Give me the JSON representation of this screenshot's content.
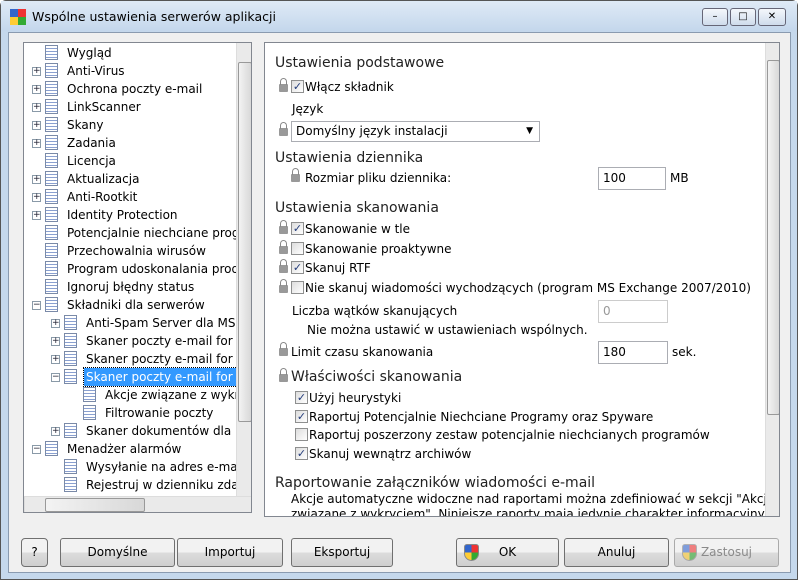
{
  "window": {
    "title": "Wspólne ustawienia serwerów aplikacji",
    "minimize": "–",
    "maximize": "□",
    "close": "✕"
  },
  "tree": [
    {
      "label": "Wygląd",
      "level": 0,
      "exp": ""
    },
    {
      "label": "Anti-Virus",
      "level": 0,
      "exp": "+"
    },
    {
      "label": "Ochrona poczty e-mail",
      "level": 0,
      "exp": "+"
    },
    {
      "label": "LinkScanner",
      "level": 0,
      "exp": "+"
    },
    {
      "label": "Skany",
      "level": 0,
      "exp": "+"
    },
    {
      "label": "Zadania",
      "level": 0,
      "exp": "+"
    },
    {
      "label": "Licencja",
      "level": 0,
      "exp": ""
    },
    {
      "label": "Aktualizacja",
      "level": 0,
      "exp": "+"
    },
    {
      "label": "Anti-Rootkit",
      "level": 0,
      "exp": "+"
    },
    {
      "label": "Identity Protection",
      "level": 0,
      "exp": "+"
    },
    {
      "label": "Potencjalnie niechciane programy",
      "level": 0,
      "exp": ""
    },
    {
      "label": "Przechowalnia wirusów",
      "level": 0,
      "exp": ""
    },
    {
      "label": "Program udoskonalania produktu",
      "level": 0,
      "exp": ""
    },
    {
      "label": "Ignoruj błędny status",
      "level": 0,
      "exp": ""
    },
    {
      "label": "Składniki dla serwerów",
      "level": 0,
      "exp": "−"
    },
    {
      "label": "Anti-Spam Server dla MS Exchange",
      "level": 1,
      "exp": "+"
    },
    {
      "label": "Skaner poczty e-mail for MS Exchange",
      "level": 1,
      "exp": "+"
    },
    {
      "label": "Skaner poczty e-mail for MS Exchange",
      "level": 1,
      "exp": "+"
    },
    {
      "label": "Skaner poczty e-mail for MS Exchange",
      "level": 1,
      "exp": "−",
      "selected": true
    },
    {
      "label": "Akcje związane z wykryciem",
      "level": 2,
      "exp": ""
    },
    {
      "label": "Filtrowanie poczty",
      "level": 2,
      "exp": ""
    },
    {
      "label": "Skaner dokumentów dla MS SharePoint",
      "level": 1,
      "exp": "+"
    },
    {
      "label": "Menadżer alarmów",
      "level": 0,
      "exp": "−"
    },
    {
      "label": "Wysyłanie na adres e-mail",
      "level": 1,
      "exp": ""
    },
    {
      "label": "Rejestruj w dzienniku zdarzeń",
      "level": 1,
      "exp": ""
    }
  ],
  "settings": {
    "basic": {
      "heading": "Ustawienia podstawowe",
      "enable_label": "Włącz składnik",
      "enable_checked": true,
      "language_label": "Język",
      "language_value": "Domyślny język instalacji"
    },
    "log": {
      "heading": "Ustawienia dziennika",
      "size_label": "Rozmiar pliku dziennika:",
      "size_value": "100",
      "size_unit": "MB"
    },
    "scan": {
      "heading": "Ustawienia skanowania",
      "options": [
        {
          "label": "Skanowanie w tle",
          "checked": true
        },
        {
          "label": "Skanowanie proaktywne",
          "checked": false
        },
        {
          "label": "Skanuj RTF",
          "checked": true
        },
        {
          "label": "Nie skanuj wiadomości wychodzących (program MS Exchange 2007/2010)",
          "checked": false
        }
      ],
      "threads_label": "Liczba wątków skanujących",
      "threads_value": "0",
      "threads_note": "Nie można ustawić w ustawieniach wspólnych.",
      "timeout_label": "Limit czasu skanowania",
      "timeout_value": "180",
      "timeout_unit": "sek."
    },
    "props": {
      "heading": "Właściwości skanowania",
      "options": [
        {
          "label": "Użyj heurystyki",
          "checked": true
        },
        {
          "label": "Raportuj Potencjalnie Niechciane Programy oraz Spyware",
          "checked": true
        },
        {
          "label": "Raportuj poszerzony zestaw potencjalnie niechcianych programów",
          "checked": false
        },
        {
          "label": "Skanuj wewnątrz archiwów",
          "checked": true
        }
      ]
    },
    "attach": {
      "heading": "Raportowanie załączników wiadomości e-mail",
      "line1": "Akcje automatyczne widoczne nad raportami można zdefiniować w sekcji \"Akcje",
      "line2": "związane z wykryciem\". Niniejsze raporty mają jedynie charakter informacyjny."
    }
  },
  "buttons": {
    "help": "?",
    "defaults": "Domyślne",
    "import": "Importuj",
    "export": "Eksportuj",
    "ok": "OK",
    "cancel": "Anuluj",
    "apply": "Zastosuj"
  }
}
